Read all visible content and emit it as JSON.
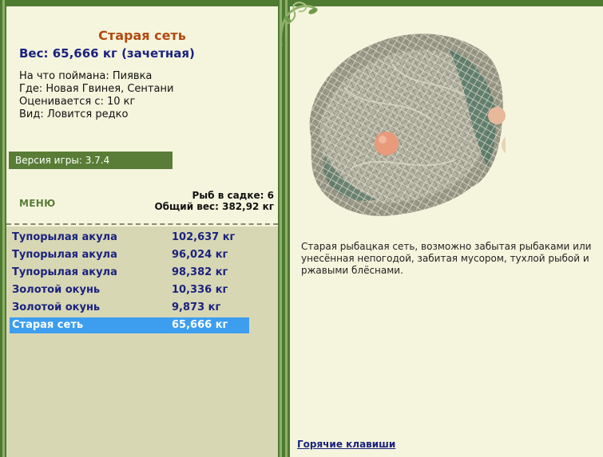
{
  "fish": {
    "title": "Старая сеть",
    "weight_line": "Вес: 65,666 кг (зачетная)",
    "caught_on": "На что поймана: Пиявка",
    "location": "Где: Новая Гвинея, Сентани",
    "valued_from": "Оценивается с: 10 кг",
    "kind": "Вид: Ловится редко"
  },
  "version": "Версия игры: 3.7.4",
  "menu_label": "МЕНЮ",
  "keepnet": {
    "count_line": "Рыб в садке: 6",
    "total_line": "Общий вес: 382,92 кг"
  },
  "catch_list": [
    {
      "name": "Тупорылая акула",
      "weight": "102,637 кг"
    },
    {
      "name": "Тупорылая акула",
      "weight": "96,024 кг"
    },
    {
      "name": "Тупорылая акула",
      "weight": "98,382 кг"
    },
    {
      "name": "Золотой окунь",
      "weight": "10,336 кг"
    },
    {
      "name": "Золотой окунь",
      "weight": "9,873 кг"
    },
    {
      "name": "Старая сеть",
      "weight": "65,666 кг"
    }
  ],
  "selected_index": 5,
  "description": "Старая рыбацкая сеть, возможно забытая рыбаками или унесённая непогодой, забитая мусором, тухлой рыбой и ржавыми блёснами.",
  "hotkeys_label": "Горячие клавиши",
  "colors": {
    "frame": "#4e7a32",
    "panel": "#f5f5de",
    "title": "#b34a10",
    "list_text": "#1a237e",
    "selected": "#3d9ef0",
    "version_bar": "#597d36"
  }
}
